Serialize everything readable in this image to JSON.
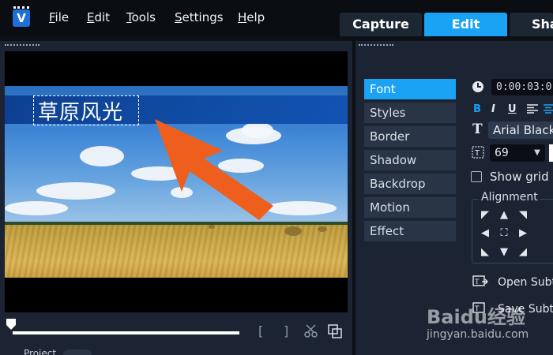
{
  "menu": {
    "items": [
      {
        "accel": "F",
        "rest": "ile"
      },
      {
        "accel": "E",
        "rest": "dit"
      },
      {
        "accel": "T",
        "rest": "ools"
      },
      {
        "accel": "S",
        "rest": "ettings"
      },
      {
        "accel": "H",
        "rest": "elp"
      }
    ]
  },
  "tabs": [
    "Capture",
    "Edit",
    "Sha"
  ],
  "active_tab": "Edit",
  "preview": {
    "title_text": "草原风光"
  },
  "transport": {
    "mark_in": "[",
    "mark_out": "]",
    "project_label": "Project"
  },
  "properties": {
    "categories": [
      "Font",
      "Styles",
      "Border",
      "Shadow",
      "Backdrop",
      "Motion",
      "Effect"
    ],
    "active_category": "Font",
    "timecode": "0:00:03:0",
    "font_name": "Arial Black",
    "font_size": "69",
    "show_grid_label": "Show grid l",
    "alignment_label": "Alignment",
    "open_subtitle": "Open Subt",
    "save_subtitle": "Save Subt"
  },
  "watermark": {
    "brand": "Baidu经验",
    "url": "jingyan.baidu.com"
  },
  "colors": {
    "accent": "#1aa3f5",
    "panel": "#1c2433",
    "arrow_annotation": "#ee5f1e"
  }
}
